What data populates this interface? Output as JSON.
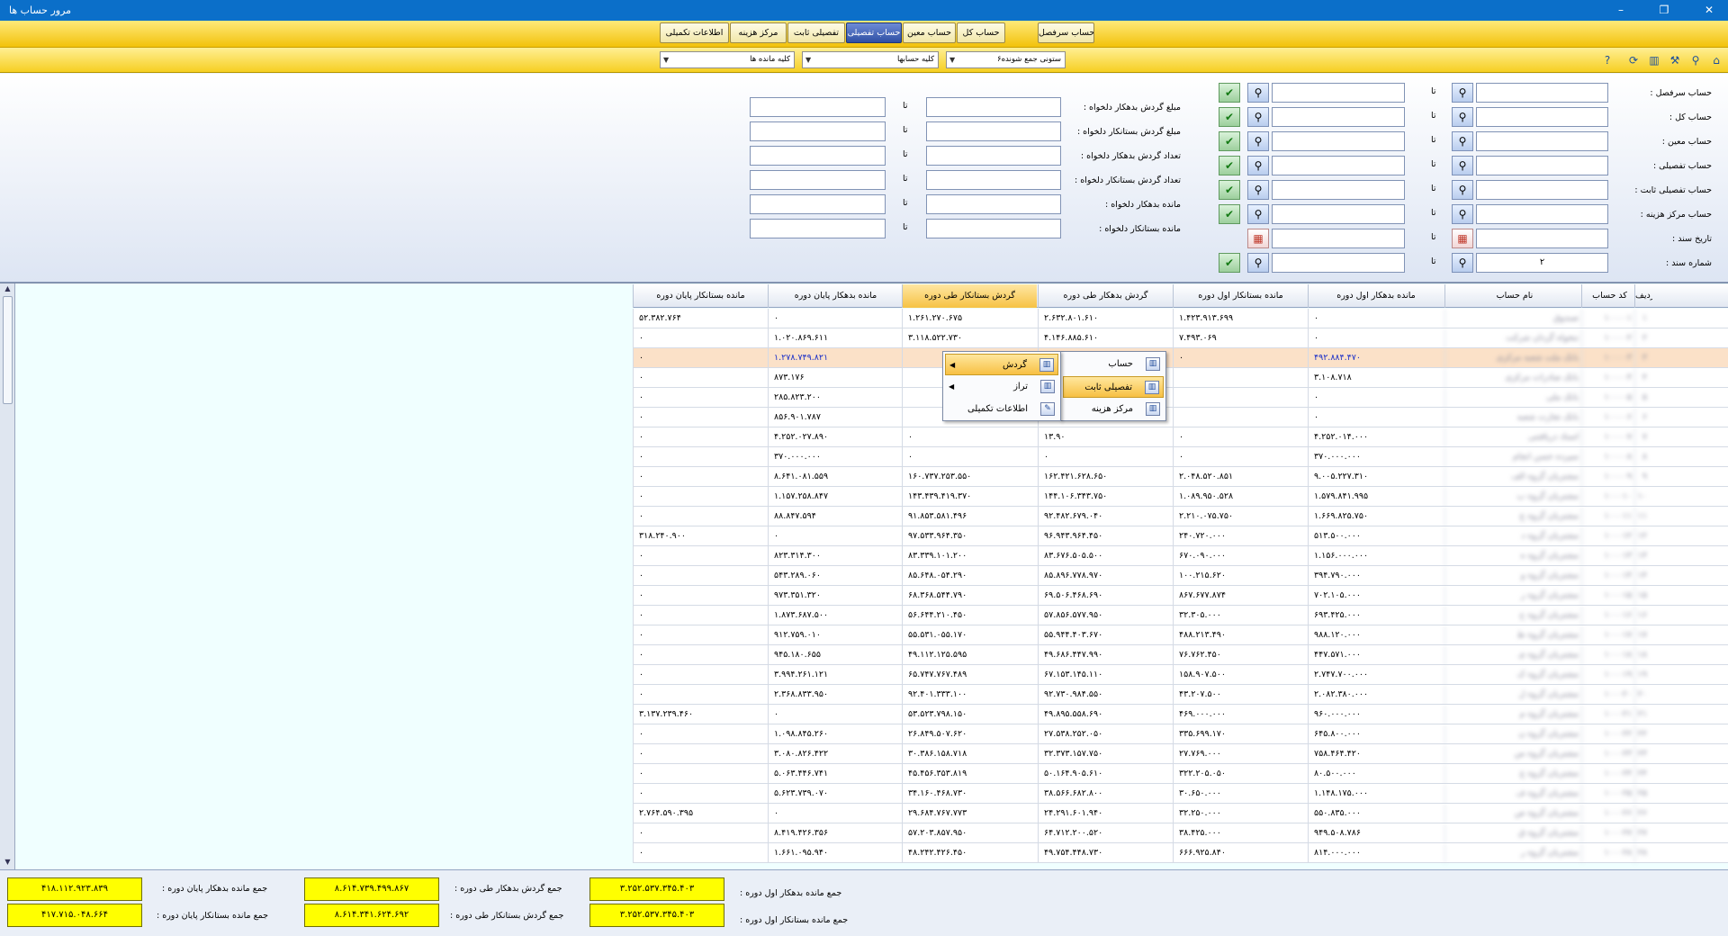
{
  "window": {
    "title": "مرور حساب ها",
    "min": "–",
    "max": "❐",
    "close": "✕"
  },
  "tabs": [
    "حساب سرفصل",
    "حساب کل",
    "حساب معین",
    "حساب تفصیلی",
    "تفصیلی ثابت",
    "مرکز هزینه",
    "اطلاعات تکمیلی"
  ],
  "active_tab": "حساب تفصیلی",
  "toolbar2": {
    "combo1": "۶ستونی جمع شونده",
    "combo2": "کلیه حسابها",
    "combo3": "کلیه مانده ها",
    "icons": [
      "home-icon",
      "filter-icon",
      "tools-icon",
      "chart-icon",
      "refresh-icon",
      "help-icon"
    ]
  },
  "filter": {
    "to": "تا",
    "right_labels": [
      "حساب سرفصل :",
      "حساب کل :",
      "حساب معین :",
      "حساب تفصیلی :",
      "حساب تفصیلی ثابت :",
      "حساب مرکز هزینه :",
      "تاریخ سند :",
      "شماره سند :"
    ],
    "mid_labels": [
      "مبلغ گردش بدهکار دلخواه :",
      "مبلغ گردش بستانکار دلخواه :",
      "تعداد گردش بدهکار دلخواه :",
      "تعداد گردش بستانکار دلخواه :",
      "مانده بدهکار دلخواه :",
      "مانده بستانکار دلخواه :"
    ],
    "doc_number_from": "۲"
  },
  "grid": {
    "headers": [
      "ردیف",
      "کد حساب",
      "نام حساب",
      "مانده بدهکار اول دوره",
      "مانده بستانکار اول دوره",
      "گردش بدهکار طی دوره",
      "گردش بستانکار طی دوره",
      "مانده بدهکار پایان دوره",
      "مانده بستانکار پایان دوره"
    ],
    "selected_header": "گردش بستانکار طی دوره",
    "rows": [
      [
        "۱",
        "۱۰۰۰۰۱",
        "صندوق",
        "۰",
        "۱.۴۲۳.۹۱۳.۶۹۹",
        "۲.۶۳۲.۸۰۱.۶۱۰",
        "۱.۲۶۱.۲۷۰.۶۷۵",
        "۰",
        "۵۲.۳۸۲.۷۶۴"
      ],
      [
        "۲",
        "۱۰۰۰۰۲",
        "تنخواه گردان شرکت",
        "۰",
        "۷.۴۹۳.۰۶۹",
        "۴.۱۴۶.۸۸۵.۶۱۰",
        "۳.۱۱۸.۵۲۲.۷۳۰",
        "۱.۰۲۰.۸۶۹.۶۱۱",
        "۰"
      ],
      [
        "۳",
        "۱۰۰۰۰۳",
        "بانک ملت شعبه مرکزی",
        "۴۹۲.۸۸۴.۴۷۰",
        "۰",
        "",
        "",
        "۱.۲۷۸.۷۴۹.۸۲۱",
        "۰"
      ],
      [
        "۴",
        "۱۰۰۰۰۴",
        "بانک صادرات مرکزی",
        "۳.۱۰۸.۷۱۸",
        "",
        "",
        "",
        "۸۷۳.۱۷۶",
        "۰"
      ],
      [
        "۵",
        "۱۰۰۰۰۵",
        "بانک ملی",
        "۰",
        "",
        "",
        "",
        "۲۸۵.۸۲۳.۲۰۰",
        "۰"
      ],
      [
        "۶",
        "۱۰۰۰۰۶",
        "بانک تجارت شعبه",
        "۰",
        "",
        "",
        "",
        "۸۵۶.۹۰۱.۷۸۷",
        "۰"
      ],
      [
        "۷",
        "۱۰۰۰۰۷",
        "اسناد دریافتنی",
        "۴.۲۵۲.۰۱۴.۰۰۰",
        "۰",
        "۱۳.۹۰",
        "۰",
        "۴.۲۵۲.۰۲۷.۸۹۰",
        "۰"
      ],
      [
        "۸",
        "۱۰۰۰۰۸",
        "سپرده حسن انجام",
        "۳۷۰.۰۰۰.۰۰۰",
        "۰",
        "۰",
        "۰",
        "۳۷۰.۰۰۰.۰۰۰",
        "۰"
      ],
      [
        "۹",
        "۱۰۰۰۰۹",
        "مشتریان گروه الف",
        "۹.۰۰۵.۲۲۷.۳۱۰",
        "۲.۰۴۸.۵۲۰.۸۵۱",
        "۱۶۲.۴۲۱.۶۲۸.۶۵۰",
        "۱۶۰.۷۳۷.۲۵۳.۵۵۰",
        "۸.۶۴۱.۰۸۱.۵۵۹",
        "۰"
      ],
      [
        "۱۰",
        "۱۰۰۰۱۰",
        "مشتریان گروه ب",
        "۱.۵۷۹.۸۴۱.۹۹۵",
        "۱.۰۸۹.۹۵۰.۵۲۸",
        "۱۴۴.۱۰۶.۳۴۳.۷۵۰",
        "۱۴۳.۴۳۹.۴۱۹.۳۷۰",
        "۱.۱۵۷.۲۵۸.۸۴۷",
        "۰"
      ],
      [
        "۱۱",
        "۱۰۰۰۱۱",
        "مشتریان گروه ج",
        "۱.۶۶۹.۸۲۵.۷۵۰",
        "۲.۲۱۰.۰۷۵.۷۵۰",
        "۹۲.۴۸۲.۶۷۹.۰۴۰",
        "۹۱.۸۵۳.۵۸۱.۴۹۶",
        "۸۸.۸۴۷.۵۹۴",
        "۰"
      ],
      [
        "۱۲",
        "۱۰۰۰۱۲",
        "مشتریان گروه د",
        "۵۱۳.۵۰۰.۰۰۰",
        "۲۴۰.۷۲۰.۰۰۰",
        "۹۶.۹۴۳.۹۶۴.۴۵۰",
        "۹۷.۵۳۳.۹۶۴.۳۵۰",
        "۰",
        "۳۱۸.۲۴۰.۹۰۰"
      ],
      [
        "۱۳",
        "۱۰۰۰۱۳",
        "مشتریان گروه ه",
        "۱.۱۵۶.۰۰۰.۰۰۰",
        "۶۷۰.۰۹۰.۰۰۰",
        "۸۳.۶۷۶.۵۰۵.۵۰۰",
        "۸۳.۳۳۹.۱۰۱.۲۰۰",
        "۸۲۳.۳۱۴.۳۰۰",
        "۰"
      ],
      [
        "۱۴",
        "۱۰۰۰۱۴",
        "مشتریان گروه و",
        "۳۹۴.۷۹۰.۰۰۰",
        "۱۰۰.۲۱۵.۶۲۰",
        "۸۵.۸۹۶.۷۷۸.۹۷۰",
        "۸۵.۶۴۸.۰۵۴.۲۹۰",
        "۵۴۳.۲۸۹.۰۶۰",
        "۰"
      ],
      [
        "۱۵",
        "۱۰۰۰۱۵",
        "مشتریان گروه ز",
        "۷۰۲.۱۰۵.۰۰۰",
        "۸۶۷.۶۷۷.۸۷۴",
        "۶۹.۵۰۶.۴۶۸.۶۹۰",
        "۶۸.۳۶۸.۵۴۴.۷۹۰",
        "۹۷۳.۳۵۱.۳۲۰",
        "۰"
      ],
      [
        "۱۶",
        "۱۰۰۰۱۶",
        "مشتریان گروه ح",
        "۶۹۳.۴۲۵.۰۰۰",
        "۳۲.۳۰۵.۰۰۰",
        "۵۷.۸۵۶.۵۷۷.۹۵۰",
        "۵۶.۶۴۴.۲۱۰.۴۵۰",
        "۱.۸۷۳.۶۸۷.۵۰۰",
        "۰"
      ],
      [
        "۱۷",
        "۱۰۰۰۱۷",
        "مشتریان گروه ط",
        "۹۸۸.۱۲۰.۰۰۰",
        "۴۸۸.۲۱۳.۴۹۰",
        "۵۵.۹۴۴.۴۰۳.۶۷۰",
        "۵۵.۵۳۱.۰۵۵.۱۷۰",
        "۹۱۲.۷۵۹.۰۱۰",
        "۰"
      ],
      [
        "۱۸",
        "۱۰۰۰۱۸",
        "مشتریان گروه ی",
        "۴۴۷.۵۷۱.۰۰۰",
        "۷۶.۷۶۲.۴۵۰",
        "۴۹.۶۸۶.۴۴۷.۹۹۰",
        "۴۹.۱۱۲.۱۲۵.۵۹۵",
        "۹۴۵.۱۸۰.۶۵۵",
        "۰"
      ],
      [
        "۱۹",
        "۱۰۰۰۱۹",
        "مشتریان گروه ک",
        "۲.۷۴۷.۷۰۰.۰۰۰",
        "۱۵۸.۹۰۷.۵۰۰",
        "۶۷.۱۵۳.۱۴۵.۱۱۰",
        "۶۵.۷۴۷.۷۶۷.۴۸۹",
        "۳.۹۹۴.۲۶۱.۱۲۱",
        "۰"
      ],
      [
        "۲۰",
        "۱۰۰۰۲۰",
        "مشتریان گروه ل",
        "۲.۰۸۲.۳۸۰.۰۰۰",
        "۴۳.۲۰۷.۵۰۰",
        "۹۲.۷۳۰.۹۸۴.۵۵۰",
        "۹۲.۴۰۱.۳۳۳.۱۰۰",
        "۲.۳۶۸.۸۳۳.۹۵۰",
        "۰"
      ],
      [
        "۲۱",
        "۱۰۰۰۲۱",
        "مشتریان گروه م",
        "۹۶۰.۰۰۰.۰۰۰",
        "۴۶۹.۰۰۰.۰۰۰",
        "۴۹.۸۹۵.۵۵۸.۶۹۰",
        "۵۳.۵۲۳.۷۹۸.۱۵۰",
        "۰",
        "۳.۱۳۷.۲۳۹.۴۶۰"
      ],
      [
        "۲۲",
        "۱۰۰۰۲۲",
        "مشتریان گروه ن",
        "۶۴۵.۸۰۰.۰۰۰",
        "۳۳۵.۶۹۹.۱۷۰",
        "۲۷.۵۳۸.۲۵۲.۰۵۰",
        "۲۶.۸۴۹.۵۰۷.۶۲۰",
        "۱.۰۹۸.۸۴۵.۲۶۰",
        "۰"
      ],
      [
        "۲۳",
        "۱۰۰۰۲۳",
        "مشتریان گروه س",
        "۷۵۸.۴۶۴.۴۲۰",
        "۲۷.۷۶۹.۰۰۰",
        "۳۲.۳۷۳.۱۵۷.۷۵۰",
        "۳۰.۳۸۶.۱۵۸.۷۱۸",
        "۳.۰۸۰.۸۲۶.۴۲۲",
        "۰"
      ],
      [
        "۲۴",
        "۱۰۰۰۲۴",
        "مشتریان گروه ع",
        "۸۰.۵۰۰.۰۰۰",
        "۳۲۲.۲۰۵.۰۵۰",
        "۵۰.۱۶۴.۹۰۵.۶۱۰",
        "۴۵.۴۵۶.۳۵۳.۸۱۹",
        "۵.۰۶۳.۴۴۶.۷۴۱",
        "۰"
      ],
      [
        "۲۵",
        "۱۰۰۰۲۵",
        "مشتریان گروه ف",
        "۱.۱۴۸.۱۷۵.۰۰۰",
        "۳۰.۶۵۰.۰۰۰",
        "۳۸.۵۶۶.۶۸۲.۸۰۰",
        "۳۴.۱۶۰.۴۶۸.۷۳۰",
        "۵.۶۲۳.۷۳۹.۰۷۰",
        "۰"
      ],
      [
        "۲۶",
        "۱۰۰۰۲۶",
        "مشتریان گروه ص",
        "۵۵۰.۸۳۵.۰۰۰",
        "۳۲.۲۵۰.۰۰۰",
        "۲۴.۲۹۱.۶۰۱.۹۴۰",
        "۲۹.۶۸۴.۷۶۷.۷۷۳",
        "۰",
        "۲.۷۶۴.۵۹۰.۳۹۵"
      ],
      [
        "۲۷",
        "۱۰۰۰۲۷",
        "مشتریان گروه ق",
        "۹۴۹.۵۰۸.۷۸۶",
        "۳۸.۴۲۵.۰۰۰",
        "۶۴.۷۱۲.۲۰۰.۵۲۰",
        "۵۷.۲۰۳.۸۵۷.۹۵۰",
        "۸.۴۱۹.۴۲۶.۳۵۶",
        "۰"
      ],
      [
        "۲۸",
        "۱۰۰۰۲۸",
        "مشتریان گروه ر",
        "۸۱۴.۰۰۰.۰۰۰",
        "۶۶۶.۹۲۵.۸۴۰",
        "۴۹.۷۵۴.۴۴۸.۷۳۰",
        "۴۸.۲۴۲.۴۲۶.۴۵۰",
        "۱.۶۶۱.۰۹۵.۹۴۰",
        "۰"
      ]
    ]
  },
  "context_menu": {
    "main": [
      {
        "label": "گردش",
        "icon": "chart-icon",
        "sub": true
      },
      {
        "label": "تراز",
        "icon": "chart-icon",
        "sub": true
      },
      {
        "label": "اطلاعات تکمیلی",
        "icon": "edit-icon",
        "sub": false
      }
    ],
    "submenu": [
      {
        "label": "حساب",
        "icon": "chart-icon"
      },
      {
        "label": "تفصیلی ثابت",
        "icon": "chart-icon"
      },
      {
        "label": "مرکز هزینه",
        "icon": "chart-icon"
      }
    ],
    "highlighted_main": "گردش",
    "highlighted_sub": "تفصیلی ثابت"
  },
  "totals": {
    "open_debit_label": "جمع مانده بدهکار اول دوره :",
    "open_debit": "۳.۲۵۲.۵۳۷.۳۴۵.۴۰۳",
    "open_credit_label": "جمع مانده بستانکار اول دوره :",
    "open_credit": "۳.۲۵۲.۵۳۷.۳۴۵.۴۰۳",
    "turn_debit_label": "جمع گردش بدهکار طی دوره :",
    "turn_debit": "۸.۶۱۴.۷۳۹.۴۹۹.۸۶۷",
    "turn_credit_label": "جمع گردش بستانکار طی دوره :",
    "turn_credit": "۸.۶۱۴.۳۴۱.۶۲۴.۶۹۲",
    "end_debit_label": "جمع مانده بدهکار پایان دوره :",
    "end_debit": "۴۱۸.۱۱۲.۹۲۳.۸۳۹",
    "end_credit_label": "جمع مانده بستانکار پایان دوره :",
    "end_credit": "۴۱۷.۷۱۵.۰۴۸.۶۶۴"
  }
}
